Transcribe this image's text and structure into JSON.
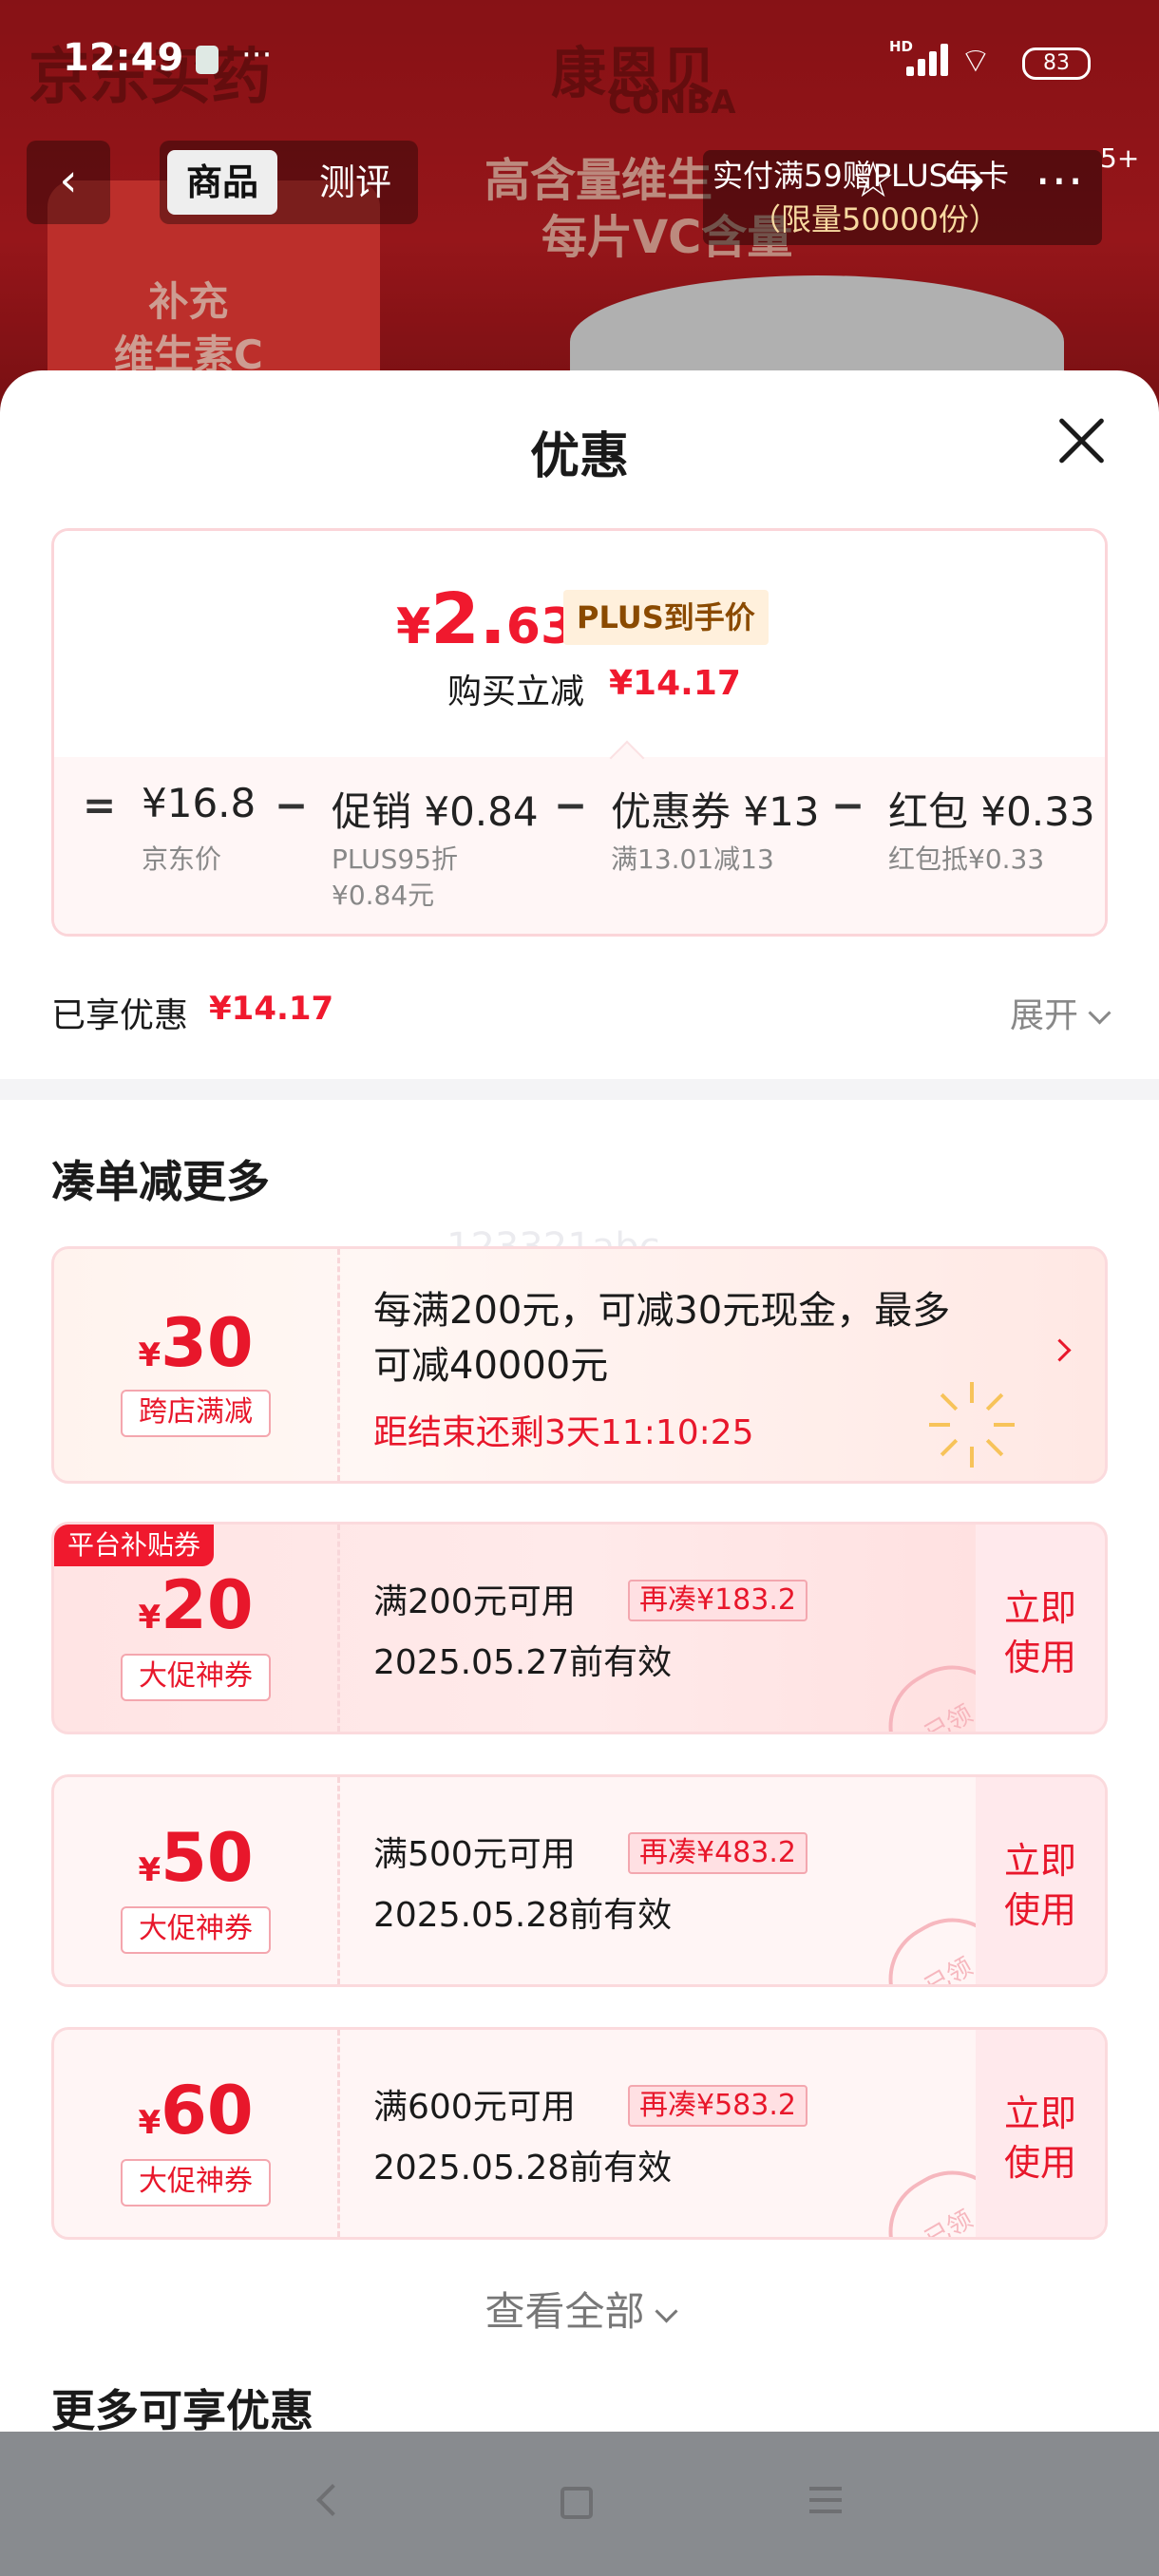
{
  "status_bar": {
    "time": "12:49",
    "dots": "···",
    "hd": "HD",
    "battery": "83"
  },
  "background": {
    "brand_left": "京东买药",
    "brand_right": "康恩贝",
    "brand_right_en": "CONBA",
    "hero_text_1": "补充",
    "hero_text_2": "维生素C",
    "banner_line1": "高含量维生",
    "banner_line2": "每片VC含量",
    "promo_line1": "实付满59赠PLUS年卡",
    "promo_line2": "（限量50000份）",
    "badge": "5+"
  },
  "nav": {
    "tab_goods": "商品",
    "tab_review": "测评"
  },
  "sheet": {
    "title": "优惠",
    "final_price_symbol": "¥",
    "final_price_int": "2.",
    "final_price_dec": "63",
    "plus_tag": "PLUS到手价",
    "instant_label": "购买立减",
    "instant_value": "¥14.17",
    "calc": {
      "equals": "=",
      "jd_price": "¥16.8",
      "jd_price_label": "京东价",
      "minus1": "−",
      "promo": "促销 ¥0.84",
      "promo_sub1": "PLUS95折",
      "promo_sub2": "¥0.84元",
      "minus2": "−",
      "coupon": "优惠券 ¥13",
      "coupon_sub": "满13.01减13",
      "minus3": "−",
      "redpacket": "红包 ¥0.33",
      "redpacket_sub": "红包抵¥0.33"
    },
    "enjoyed_label": "已享优惠",
    "enjoyed_value": "¥14.17",
    "expand": "展开",
    "section_more": "凑单减更多",
    "watermark": "123321abc",
    "coupons": [
      {
        "symbol": "¥",
        "amount": "30",
        "tag": "跨店满减",
        "desc_line1": "每满200元，可减30元现金，最多",
        "desc_line2": "可减40000元",
        "countdown": "距结束还剩3天11:10:25"
      },
      {
        "badge": "平台补贴券",
        "symbol": "¥",
        "amount": "20",
        "tag": "大促神券",
        "condition": "满200元可用",
        "again": "再凑¥183.2",
        "valid": "2025.05.27前有效",
        "use_1": "立即",
        "use_2": "使用",
        "stamp": "已领"
      },
      {
        "symbol": "¥",
        "amount": "50",
        "tag": "大促神券",
        "condition": "满500元可用",
        "again": "再凑¥483.2",
        "valid": "2025.05.28前有效",
        "use_1": "立即",
        "use_2": "使用",
        "stamp": "已领"
      },
      {
        "symbol": "¥",
        "amount": "60",
        "tag": "大促神券",
        "condition": "满600元可用",
        "again": "再凑¥583.2",
        "valid": "2025.05.28前有效",
        "use_1": "立即",
        "use_2": "使用",
        "stamp": "已领"
      }
    ],
    "view_all": "查看全部",
    "section_more2": "更多可享优惠"
  },
  "icons": {
    "back": "chevron-left-icon",
    "star": "star-icon",
    "share": "share-icon",
    "more": "more-icon",
    "close": "close-icon"
  },
  "colors": {
    "accent": "#f0192e",
    "plus_tag_bg": "#fff0dc",
    "card_border": "#fbd5d9"
  }
}
